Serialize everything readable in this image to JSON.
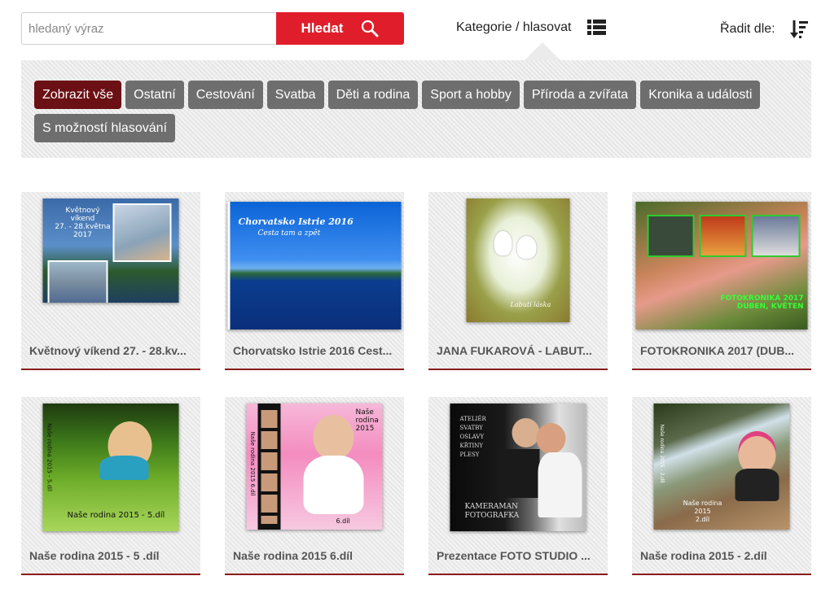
{
  "search": {
    "placeholder": "hledaný výraz",
    "button_label": "Hledat"
  },
  "header": {
    "category_label": "Kategorie / hlasovat",
    "sort_label": "Řadit dle:"
  },
  "categories": [
    {
      "label": "Zobrazit vše",
      "active": true
    },
    {
      "label": "Ostatní"
    },
    {
      "label": "Cestování"
    },
    {
      "label": "Svatba"
    },
    {
      "label": "Děti a rodina"
    },
    {
      "label": "Sport a hobby"
    },
    {
      "label": "Příroda a zvířata"
    },
    {
      "label": "Kronika a události"
    },
    {
      "label": "S možností hlasování"
    }
  ],
  "albums": [
    {
      "title": "Květnový víkend 27. - 28.kv...",
      "cover_text": [
        "Květnový",
        "víkend",
        "27. - 28.května",
        "2017"
      ]
    },
    {
      "title": "Chorvatsko Istrie 2016 Cest...",
      "cover_text": [
        "Chorvatsko Istrie 2016",
        "Cesta tam a zpět"
      ]
    },
    {
      "title": "JANA FUKAROVÁ - LABUT...",
      "cover_text": [
        "Labutí láska"
      ]
    },
    {
      "title": "FOTOKRONIKA 2017 (DUB...",
      "cover_text": [
        "FOTOKRONIKA 2017",
        "DUBEN, KVĚTEN"
      ]
    },
    {
      "title": "Naše rodina 2015 - 5 .díl",
      "cover_text": [
        "Naše rodina 2015 - 5.díl",
        "Naše rodina 2015 - 5.díl"
      ]
    },
    {
      "title": "Naše rodina 2015 6.díl",
      "cover_text": [
        "Naše",
        "rodina",
        "2015",
        "Naše rodina 2015   6.díl",
        "6.díl"
      ]
    },
    {
      "title": "Prezentace FOTO STUDIO ...",
      "cover_text": [
        "ATELIÉR",
        "SVATBY",
        "OSLAVY",
        "KŘTINY",
        "PLESY",
        "KAMERAMAN",
        "FOTOGRAFKA"
      ]
    },
    {
      "title": "Naše rodina 2015 - 2.díl",
      "cover_text": [
        "Naše rodina",
        "2015",
        "2.díl",
        "Naše rodina 2015 - 2.díl"
      ]
    }
  ],
  "colors": {
    "accent": "#e01e2b",
    "active_category": "#6b1014",
    "category_button": "#6e6e6e",
    "card_border": "#8b1a1a"
  }
}
